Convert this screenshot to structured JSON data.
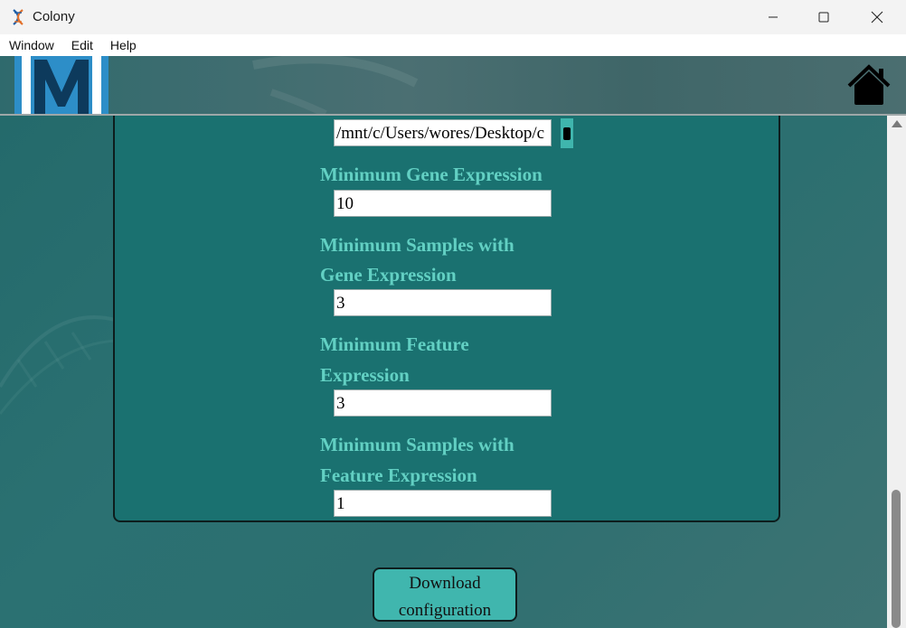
{
  "window": {
    "title": "Colony",
    "controls": [
      "minimize-icon",
      "maximize-icon",
      "close-icon"
    ]
  },
  "menu": {
    "items": [
      "Window",
      "Edit",
      "Help"
    ]
  },
  "header": {
    "logo_text": "M",
    "home_icon": "home-icon"
  },
  "form": {
    "path_value": "/mnt/c/Users/wores/Desktop/c",
    "min_gene_expression": {
      "label": "Minimum Gene Expression",
      "value": "10"
    },
    "min_samples_gene": {
      "label_line1": "Minimum Samples with",
      "label_line2": "Gene Expression",
      "value": "3"
    },
    "min_feature_expression": {
      "label_line1": "Minimum Feature",
      "label_line2": "Expression",
      "value": "3"
    },
    "min_samples_feature": {
      "label_line1": "Minimum Samples with",
      "label_line2": "Feature Expression",
      "value": "1"
    }
  },
  "actions": {
    "download_line1": "Download",
    "download_line2": "configuration"
  },
  "colors": {
    "panel": "#1a7170",
    "label": "#62d0c3",
    "button": "#40b6ae"
  }
}
